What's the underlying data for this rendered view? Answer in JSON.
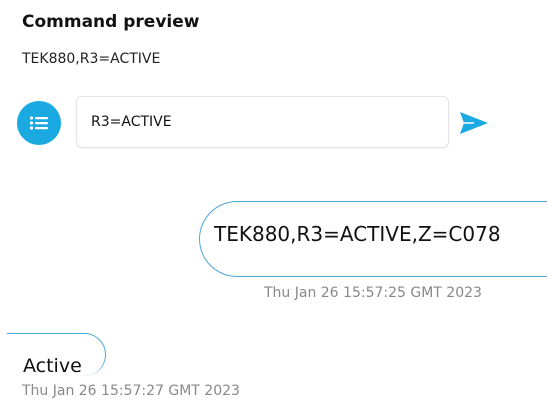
{
  "preview": {
    "title": "Command preview",
    "command": "TEK880,R3=ACTIVE"
  },
  "composer": {
    "input_value": "R3=ACTIVE",
    "menu_icon": "list-icon",
    "send_icon": "send-icon"
  },
  "messages": [
    {
      "direction": "outgoing",
      "text": "TEK880,R3=ACTIVE,Z=C078",
      "timestamp": "Thu Jan 26 15:57:25 GMT 2023"
    },
    {
      "direction": "incoming",
      "text": "Active",
      "timestamp": "Thu Jan 26 15:57:27 GMT 2023"
    }
  ],
  "colors": {
    "accent": "#1aa9e0",
    "bubble_border": "#4ea6dc",
    "timestamp": "#888888"
  }
}
